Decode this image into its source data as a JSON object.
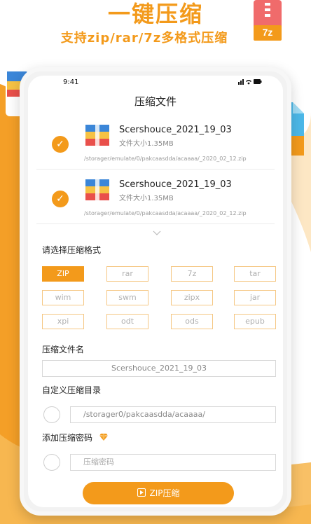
{
  "hero": {
    "title": "一键压缩",
    "subtitle": "支持zip/rar/7z多格式压缩"
  },
  "status": {
    "time": "9:41",
    "icons": "▮▮▮ ◠ ▬"
  },
  "screen": {
    "title": "压缩文件"
  },
  "files": [
    {
      "name": "Scershouce_2021_19_03",
      "size": "文件大小1.35MB",
      "path": "/storager/emulate/0/pakcaasdda/acaaaa/_2020_02_12.zip",
      "checked": true
    },
    {
      "name": "Scershouce_2021_19_03",
      "size": "文件大小1.35MB",
      "path": "/storager/emulate/0/pakcaasdda/acaaaa/_2020_02_12.zip",
      "checked": true
    }
  ],
  "format": {
    "label": "请选择压缩格式",
    "selected": "ZIP",
    "options": [
      "ZIP",
      "rar",
      "7z",
      "tar",
      "wim",
      "swm",
      "zipx",
      "jar",
      "xpi",
      "odt",
      "ods",
      "epub"
    ]
  },
  "name_field": {
    "label": "压缩文件名",
    "value": "Scershouce_2021_19_03"
  },
  "dir_field": {
    "label": "自定义压缩目录",
    "value": "/storager0/pakcaasdda/acaaaa/"
  },
  "pwd_field": {
    "label": "添加压缩密码",
    "placeholder": "压缩密码"
  },
  "action": {
    "label": "ZIP压缩"
  },
  "badges": {
    "zip": "zip",
    "tar": "tar",
    "seven_z": "7z"
  },
  "colors": {
    "accent": "#f39a1b",
    "accent_light": "#f5c783",
    "zip_badge_top": "#3b86d8",
    "tar_badge": "#4cb8e8",
    "seven_badge": "#f06b6b"
  }
}
